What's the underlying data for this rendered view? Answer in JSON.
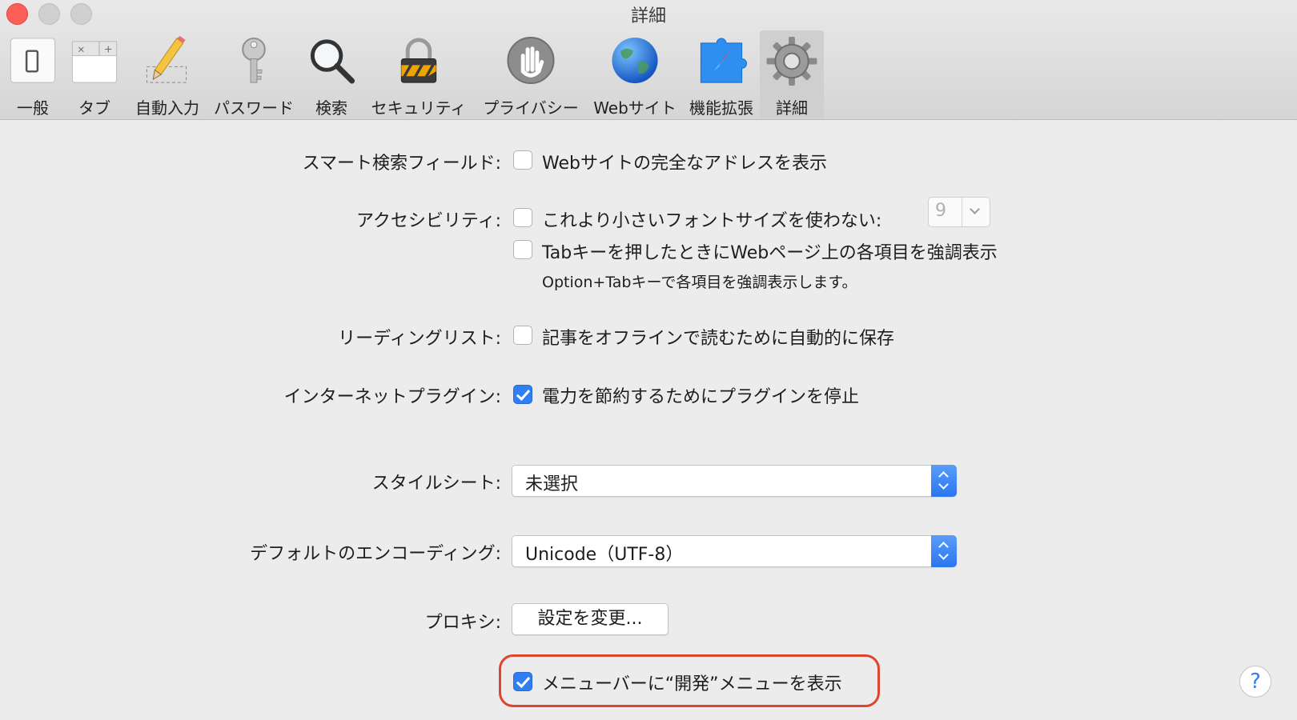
{
  "window": {
    "title": "詳細"
  },
  "toolbar": {
    "items": [
      {
        "label": "一般",
        "icon": "general-switch-icon"
      },
      {
        "label": "タブ",
        "icon": "tabs-icon"
      },
      {
        "label": "自動入力",
        "icon": "pencil-icon"
      },
      {
        "label": "パスワード",
        "icon": "key-icon"
      },
      {
        "label": "検索",
        "icon": "magnifier-icon"
      },
      {
        "label": "セキュリティ",
        "icon": "padlock-icon"
      },
      {
        "label": "プライバシー",
        "icon": "hand-icon"
      },
      {
        "label": "Webサイト",
        "icon": "globe-icon"
      },
      {
        "label": "機能拡張",
        "icon": "extension-puzzle-icon"
      },
      {
        "label": "詳細",
        "icon": "gear-icon"
      }
    ],
    "selected": "詳細"
  },
  "settings": {
    "smart_search": {
      "label": "スマート検索フィールド:",
      "option": "Webサイトの完全なアドレスを表示",
      "checked": false
    },
    "accessibility": {
      "label": "アクセシビリティ:",
      "option1": "これより小さいフォントサイズを使わない:",
      "option1_checked": false,
      "font_size": "9",
      "option2": "Tabキーを押したときにWebページ上の各項目を強調表示",
      "option2_checked": false,
      "note": "Option+Tabキーで各項目を強調表示します。"
    },
    "reading_list": {
      "label": "リーディングリスト:",
      "option": "記事をオフラインで読むために自動的に保存",
      "checked": false
    },
    "plugins": {
      "label": "インターネットプラグイン:",
      "option": "電力を節約するためにプラグインを停止",
      "checked": true
    },
    "stylesheet": {
      "label": "スタイルシート:",
      "value": "未選択"
    },
    "encoding": {
      "label": "デフォルトのエンコーディング:",
      "value": "Unicode（UTF-8）"
    },
    "proxy": {
      "label": "プロキシ:",
      "button": "設定を変更..."
    },
    "develop_menu": {
      "option": "メニューバーに“開発”メニューを表示",
      "checked": true
    }
  },
  "help": {
    "label": "?"
  },
  "colors": {
    "accent": "#2f7ff2",
    "highlight_ring": "#e0442e"
  }
}
